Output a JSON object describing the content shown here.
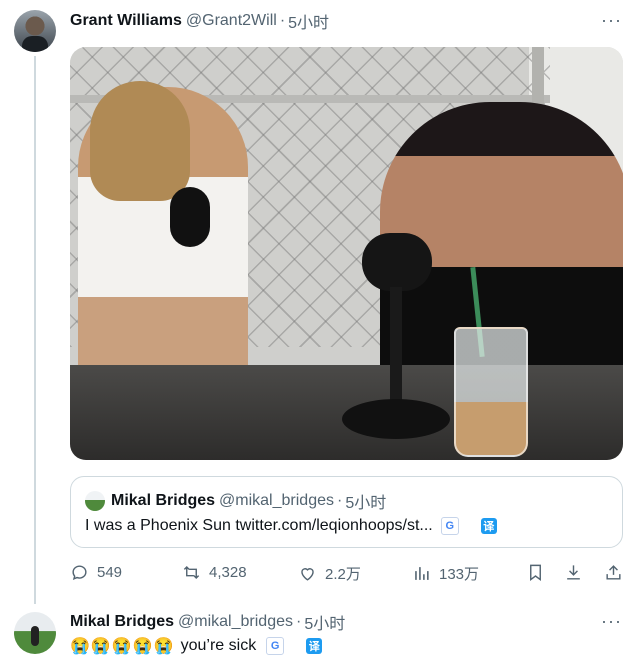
{
  "tweet": {
    "author_name": "Grant Williams",
    "author_handle": "@Grant2Will",
    "separator": "·",
    "time": "5小时",
    "more": "···",
    "media_alt": "",
    "quote": {
      "author_name": "Mikal Bridges",
      "author_handle": "@mikal_bridges",
      "separator": "·",
      "time": "5小时",
      "text": "I was a Phoenix Sun twitter.com/leqionhoops/st...",
      "translate_label": "译"
    },
    "actions": {
      "replies": "549",
      "retweets": "4,328",
      "likes": "2.2万",
      "views": "133万"
    }
  },
  "reply": {
    "author_name": "Mikal Bridges",
    "author_handle": "@mikal_bridges",
    "separator": "·",
    "time": "5小时",
    "more": "···",
    "emojis": [
      "😭",
      "😭",
      "😭",
      "😭",
      "😭"
    ],
    "text": "you’re sick",
    "translate_label": "译"
  },
  "colors": {
    "accent": "#1d9bf0",
    "muted": "#536471",
    "border": "#cfd9de"
  }
}
